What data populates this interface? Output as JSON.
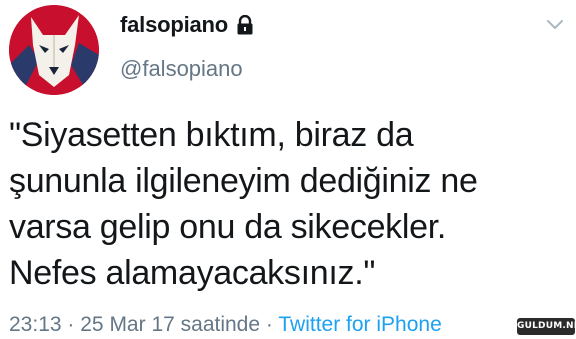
{
  "user": {
    "display_name": "falsopiano",
    "handle": "@falsopiano",
    "protected_icon": "lock-icon",
    "avatar_icon": "wolf-avatar"
  },
  "tweet": {
    "lines": [
      "\"Siyasetten bıktım, biraz da",
      "şununla ilgileneyim dediğiniz ne",
      "varsa gelip onu da sikecekler.",
      "Nefes alamayacaksınız.\""
    ],
    "time": "23:13",
    "separator": "·",
    "date": "25 Mar 17 saatinde",
    "source": "Twitter for iPhone"
  },
  "menu_icon": "chevron-down-icon",
  "watermark": "GULDUM.NET",
  "colors": {
    "text": "#14171a",
    "secondary": "#657786",
    "link": "#1da1f2",
    "avatar_red": "#c8102e"
  }
}
